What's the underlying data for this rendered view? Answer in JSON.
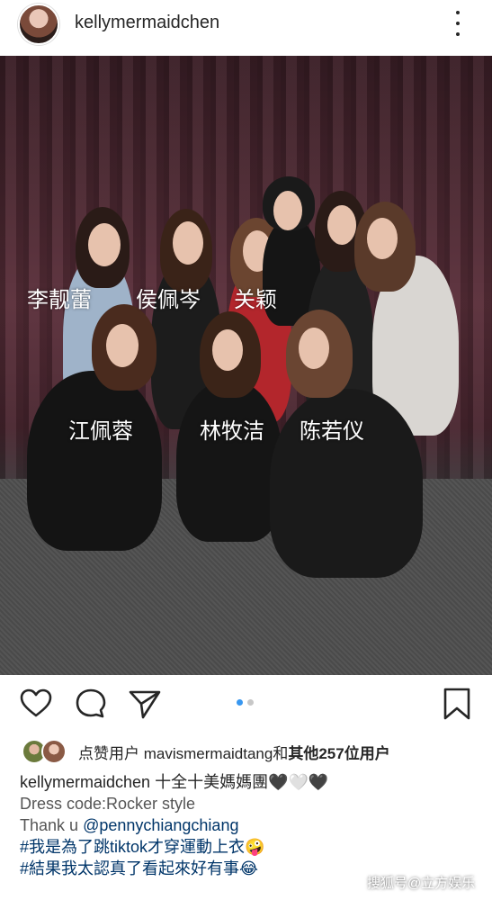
{
  "post": {
    "username": "kellymermaidchen",
    "slide_count": 2,
    "active_slide": 1
  },
  "photo": {
    "labels": {
      "row1_a": "李靓蕾",
      "row1_b": "侯佩岑",
      "row1_c": "关颖",
      "row2_a": "江佩蓉",
      "row2_b": "林牧洁",
      "row2_c": "陈若仪"
    }
  },
  "icons": {
    "more": "more-vertical-icon",
    "like": "heart-icon",
    "comment": "comment-icon",
    "share": "send-icon",
    "save": "bookmark-icon"
  },
  "likes": {
    "prefix": "点赞用户",
    "user": "mavismermaidtang",
    "joiner": "和",
    "others": "其他257位用户"
  },
  "caption": {
    "author": "kellymermaidchen",
    "line1_text": "十全十美媽媽團🖤🤍🖤",
    "line2": "Dress code:Rocker style",
    "line3_prefix": "Thank u",
    "line3_mention": "@pennychiangchiang",
    "line4": "#我是為了跳tiktok才穿運動上衣🤪",
    "line5": "#結果我太認真了看起來好有事😂"
  },
  "watermark": "搜狐号@立方娱乐",
  "colors": {
    "text": "#262626",
    "link": "#003569",
    "pager_active": "#3897f0",
    "pager_inactive": "#c7c7c7"
  }
}
